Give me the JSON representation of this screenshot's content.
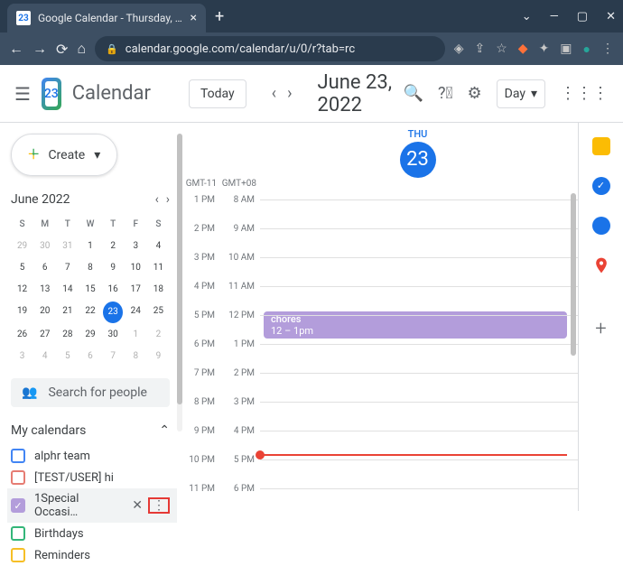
{
  "browser": {
    "tab_title": "Google Calendar - Thursday, Jun…",
    "tab_favicon": "23",
    "url": "calendar.google.com/calendar/u/0/r?tab=rc"
  },
  "app": {
    "logo_day": "23",
    "name": "Calendar",
    "today_btn": "Today",
    "date_title": "June 23, 2022",
    "view_label": "Day"
  },
  "create_label": "Create",
  "mini_cal": {
    "title": "June 2022",
    "dow": [
      "S",
      "M",
      "T",
      "W",
      "T",
      "F",
      "S"
    ],
    "weeks": [
      [
        {
          "d": "29",
          "dim": true
        },
        {
          "d": "30",
          "dim": true
        },
        {
          "d": "31",
          "dim": true
        },
        {
          "d": "1"
        },
        {
          "d": "2"
        },
        {
          "d": "3"
        },
        {
          "d": "4"
        }
      ],
      [
        {
          "d": "5"
        },
        {
          "d": "6"
        },
        {
          "d": "7"
        },
        {
          "d": "8"
        },
        {
          "d": "9"
        },
        {
          "d": "10"
        },
        {
          "d": "11"
        }
      ],
      [
        {
          "d": "12"
        },
        {
          "d": "13"
        },
        {
          "d": "14"
        },
        {
          "d": "15"
        },
        {
          "d": "16"
        },
        {
          "d": "17"
        },
        {
          "d": "18"
        }
      ],
      [
        {
          "d": "19"
        },
        {
          "d": "20"
        },
        {
          "d": "21"
        },
        {
          "d": "22"
        },
        {
          "d": "23",
          "today": true
        },
        {
          "d": "24"
        },
        {
          "d": "25"
        }
      ],
      [
        {
          "d": "26"
        },
        {
          "d": "27"
        },
        {
          "d": "28"
        },
        {
          "d": "29"
        },
        {
          "d": "30"
        },
        {
          "d": "1",
          "dim": true
        },
        {
          "d": "2",
          "dim": true
        }
      ],
      [
        {
          "d": "3",
          "dim": true
        },
        {
          "d": "4",
          "dim": true
        },
        {
          "d": "5",
          "dim": true
        },
        {
          "d": "6",
          "dim": true
        },
        {
          "d": "7",
          "dim": true
        },
        {
          "d": "8",
          "dim": true
        },
        {
          "d": "9",
          "dim": true
        }
      ]
    ]
  },
  "search_placeholder": "Search for people",
  "my_calendars": {
    "title": "My calendars",
    "items": [
      {
        "label": "alphr team",
        "color": "#4285f4",
        "checked": false
      },
      {
        "label": "[TEST/USER] hi",
        "color": "#e67c73",
        "checked": false
      },
      {
        "label": "1Special Occasi…",
        "color": "#b39ddb",
        "checked": true,
        "hover": true
      },
      {
        "label": "Birthdays",
        "color": "#33b679",
        "checked": false
      },
      {
        "label": "Reminders",
        "color": "#f6bf26",
        "checked": false
      }
    ]
  },
  "day_view": {
    "dow": "THU",
    "day": "23",
    "tz1": "GMT-11",
    "tz2": "GMT+08",
    "hours": [
      {
        "l": "1 PM",
        "r": "8 AM"
      },
      {
        "l": "2 PM",
        "r": "9 AM"
      },
      {
        "l": "3 PM",
        "r": "10 AM"
      },
      {
        "l": "4 PM",
        "r": "11 AM"
      },
      {
        "l": "5 PM",
        "r": "12 PM"
      },
      {
        "l": "6 PM",
        "r": "1 PM"
      },
      {
        "l": "7 PM",
        "r": "2 PM"
      },
      {
        "l": "8 PM",
        "r": "3 PM"
      },
      {
        "l": "9 PM",
        "r": "4 PM"
      },
      {
        "l": "10 PM",
        "r": "5 PM"
      },
      {
        "l": "11 PM",
        "r": "6 PM"
      }
    ],
    "event": {
      "title": "chores",
      "time": "12 – 1pm"
    }
  }
}
